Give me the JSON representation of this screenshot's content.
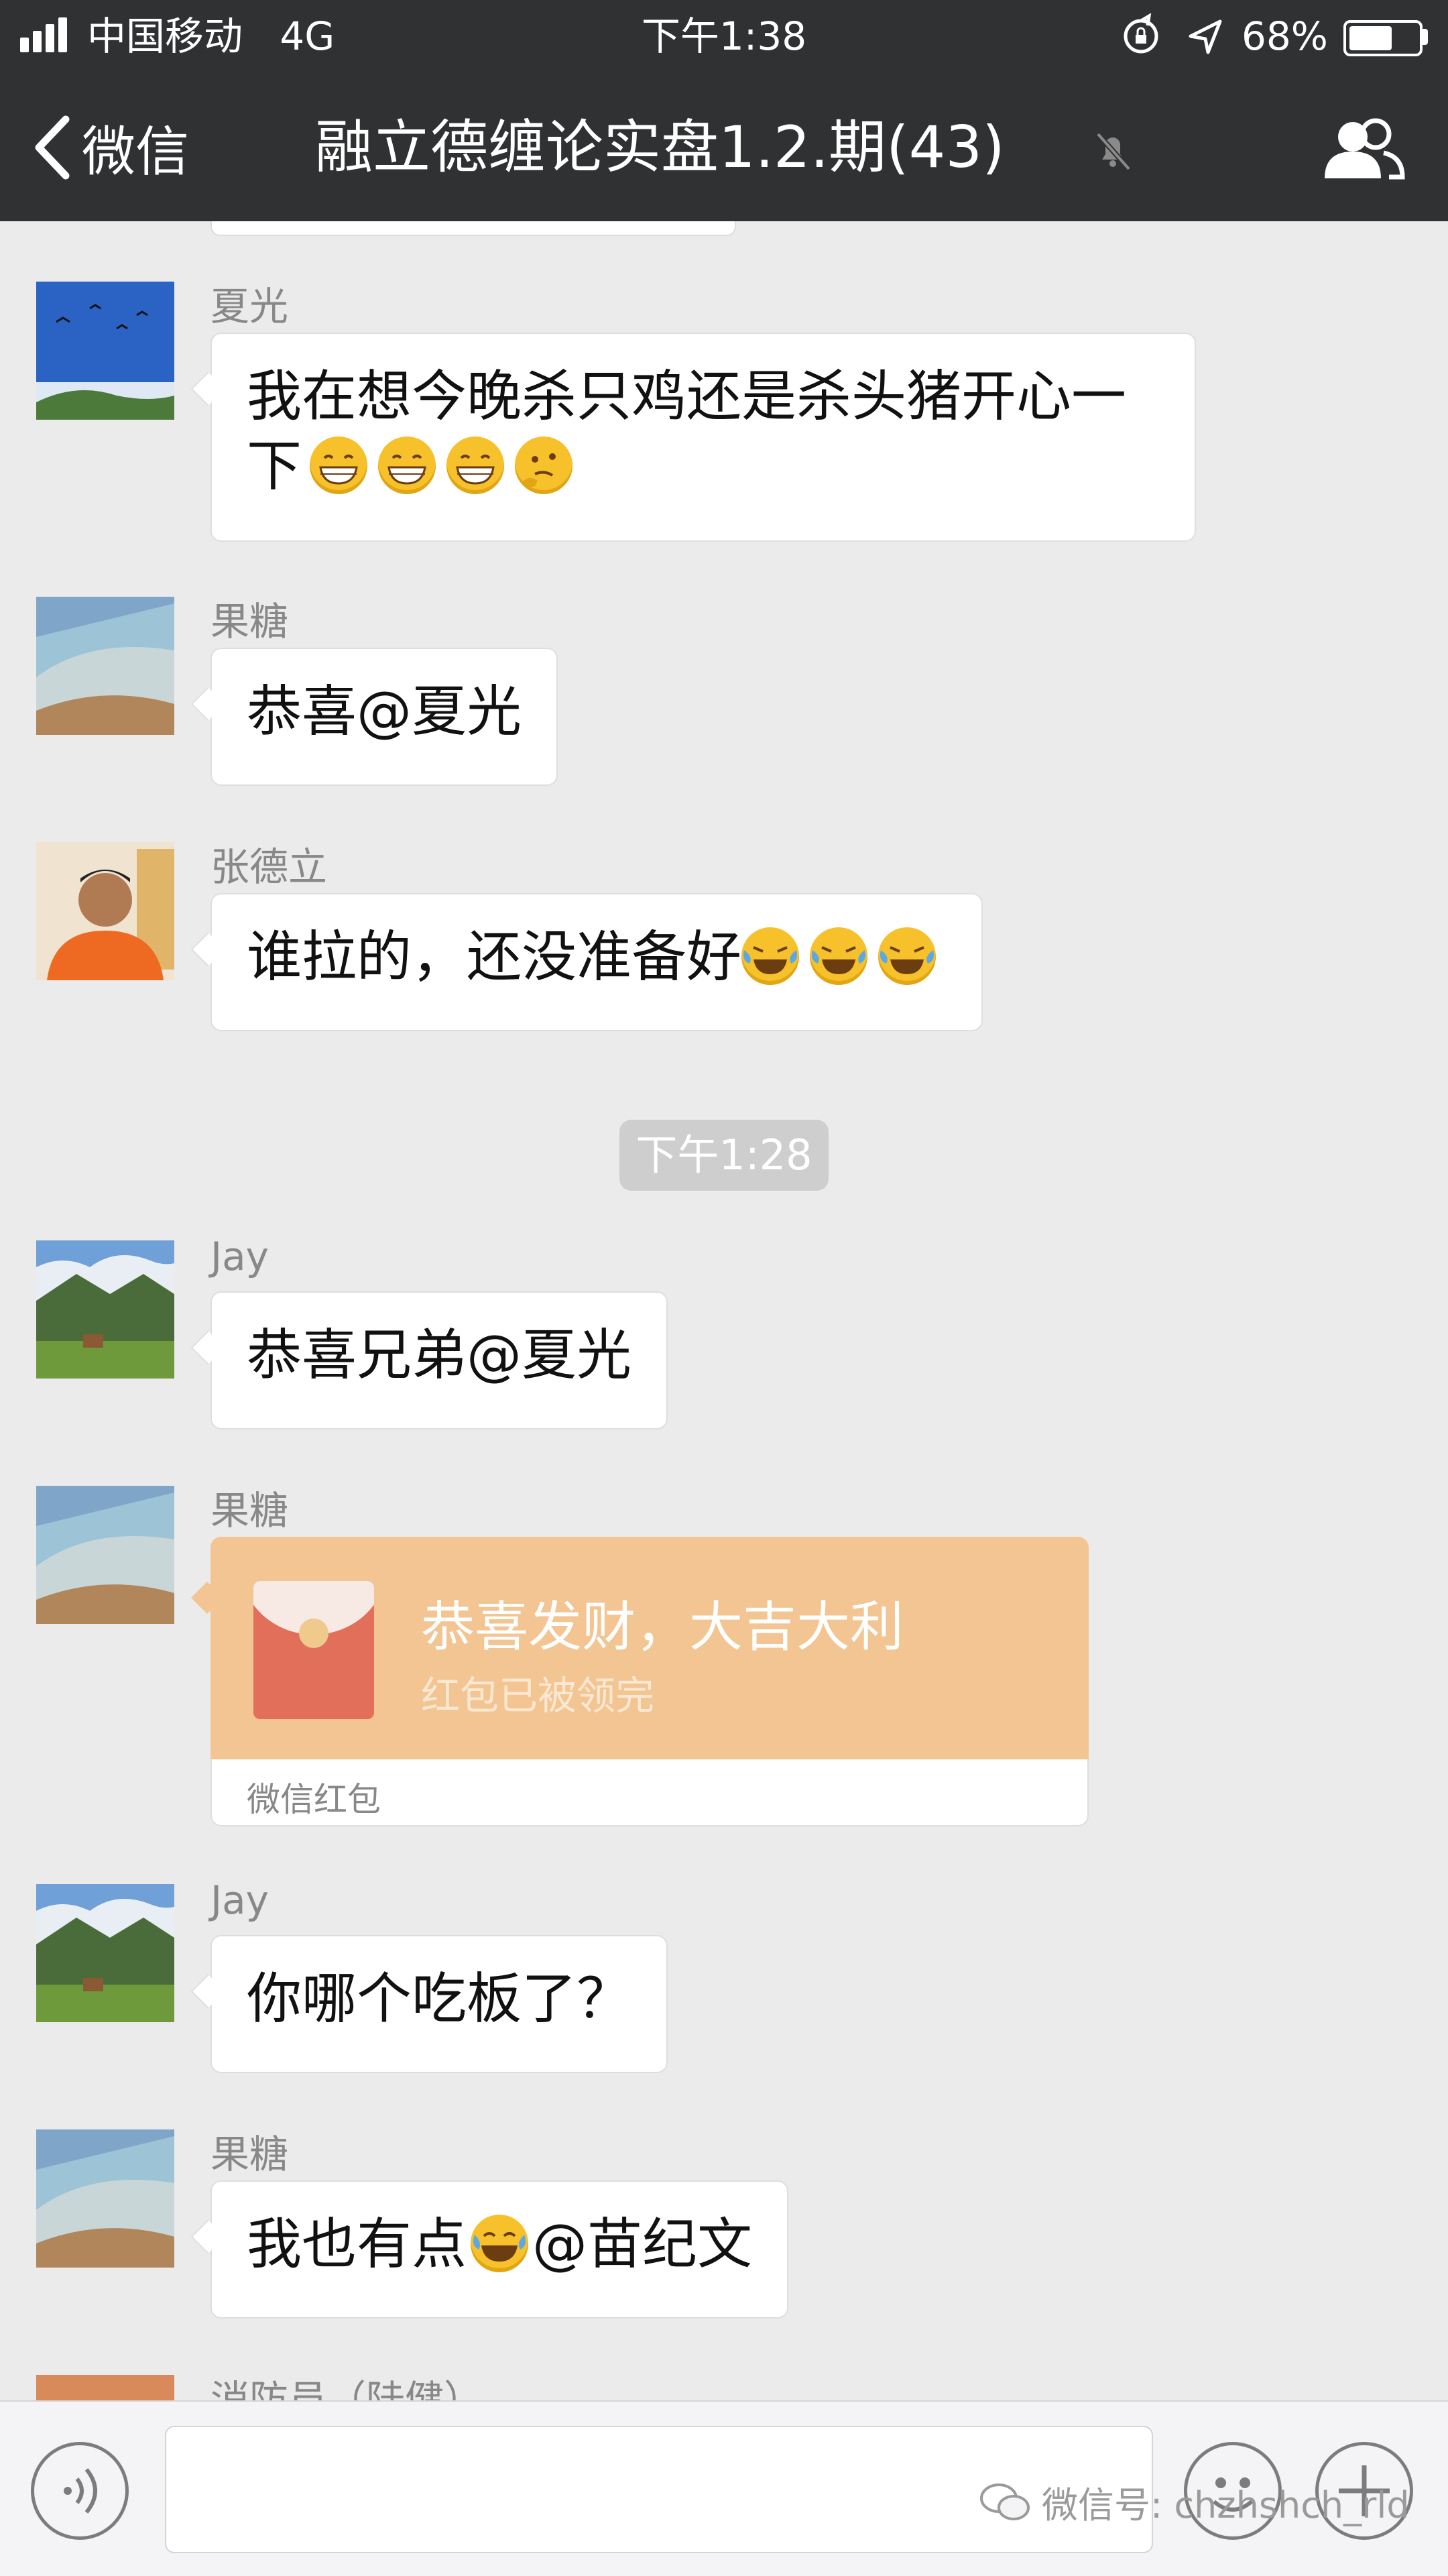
{
  "status_bar": {
    "carrier": "中国移动",
    "network": "4G",
    "time": "下午1:38",
    "battery_percent": "68%",
    "battery_level": 0.68
  },
  "nav": {
    "back_label": "微信",
    "title": "融立德缠论实盘1.2.期(43)"
  },
  "chat": {
    "timestamp": "下午1:28",
    "messages": [
      {
        "sender": "夏光",
        "text_line1": "我在想今晚杀只鸡还是杀头猪开心一",
        "text_line2": "下"
      },
      {
        "sender": "果糖",
        "text": "恭喜@夏光"
      },
      {
        "sender": "张德立",
        "text": "谁拉的，还没准备好"
      },
      {
        "sender": "Jay",
        "text": "恭喜兄弟@夏光"
      },
      {
        "sender": "果糖",
        "red_packet": {
          "title": "恭喜发财，大吉大利",
          "subtitle": "红包已被领完",
          "label": "微信红包"
        }
      },
      {
        "sender": "Jay",
        "text": "你哪个吃板了？"
      },
      {
        "sender": "果糖",
        "text_before": "我也有点",
        "text_after": "@苗纪文"
      },
      {
        "sender": "消防员（陆健）"
      }
    ]
  },
  "input_bar": {
    "watermark": "微信号: chzhshch_rld"
  },
  "colors": {
    "header_bg": "#303133",
    "chat_bg": "#ebebeb",
    "red_packet": "#f2c593",
    "emoji_yellow": "#f6c12a"
  }
}
